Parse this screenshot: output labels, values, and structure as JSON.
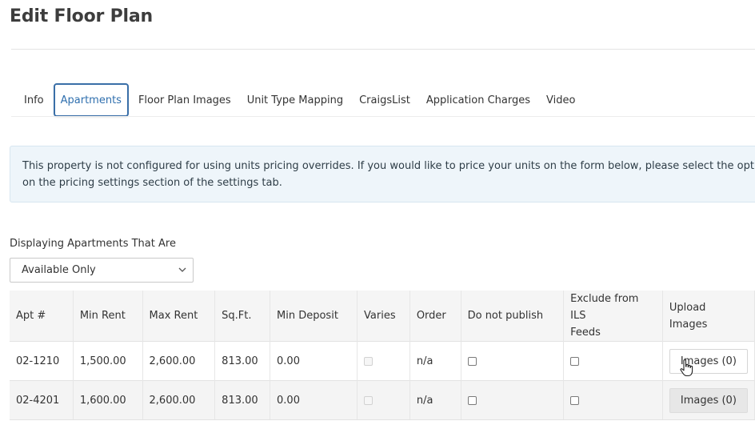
{
  "page": {
    "title": "Edit Floor Plan"
  },
  "tabs": [
    {
      "label": "Info",
      "active": false
    },
    {
      "label": "Apartments",
      "active": true
    },
    {
      "label": "Floor Plan Images",
      "active": false
    },
    {
      "label": "Unit Type Mapping",
      "active": false
    },
    {
      "label": "CraigsList",
      "active": false
    },
    {
      "label": "Application Charges",
      "active": false
    },
    {
      "label": "Video",
      "active": false
    }
  ],
  "notice": {
    "line1": "This property is not configured for using units pricing overrides. If you would like to price your units on the form below, please select the option to",
    "line2": "on the pricing settings section of the settings tab."
  },
  "filter": {
    "label": "Displaying Apartments That Are",
    "selected": "Available Only",
    "icon": "chevron-down-icon"
  },
  "table": {
    "headers": {
      "apt": "Apt #",
      "min_rent": "Min Rent",
      "max_rent": "Max Rent",
      "sqft": "Sq.Ft.",
      "min_deposit": "Min Deposit",
      "varies": "Varies",
      "order": "Order",
      "do_not_publish": "Do not publish",
      "exclude_line1": "Exclude from ILS",
      "exclude_line2": "Feeds",
      "upload_line1": "Upload",
      "upload_line2": "Images"
    },
    "rows": [
      {
        "apt": "02-1210",
        "min_rent": "1,500.00",
        "max_rent": "2,600.00",
        "sqft": "813.00",
        "min_deposit": "0.00",
        "varies": false,
        "order": "n/a",
        "do_not_publish": false,
        "exclude": false,
        "images_label": "Images (0)"
      },
      {
        "apt": "02-4201",
        "min_rent": "1,600.00",
        "max_rent": "2,600.00",
        "sqft": "813.00",
        "min_deposit": "0.00",
        "varies": false,
        "order": "n/a",
        "do_not_publish": false,
        "exclude": false,
        "images_label": "Images (0)"
      }
    ]
  },
  "colors": {
    "accent": "#2f6fae",
    "notice_bg": "#eef5fa",
    "header_bg": "#f5f5f5"
  }
}
